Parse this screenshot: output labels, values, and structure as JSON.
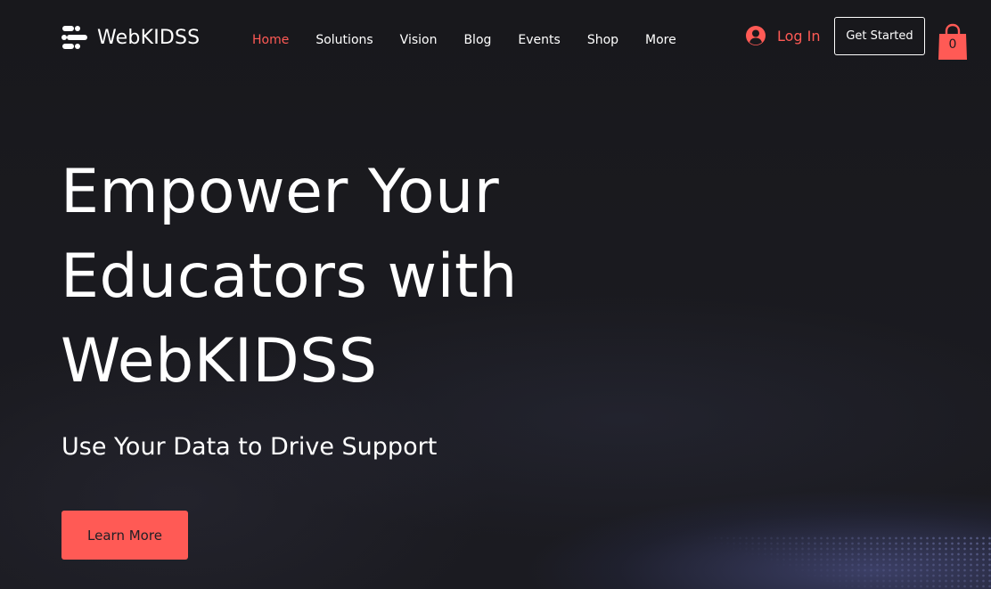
{
  "brand": {
    "name": "WebKIDSS",
    "logo_icon": "webkidss-logo-icon"
  },
  "nav": {
    "items": [
      {
        "label": "Home",
        "active": true
      },
      {
        "label": "Solutions",
        "active": false
      },
      {
        "label": "Vision",
        "active": false
      },
      {
        "label": "Blog",
        "active": false
      },
      {
        "label": "Events",
        "active": false
      },
      {
        "label": "Shop",
        "active": false
      },
      {
        "label": "More",
        "active": false
      }
    ]
  },
  "account": {
    "login_label": "Log In",
    "login_icon": "user-avatar-icon"
  },
  "header": {
    "cta_label": "Get Started"
  },
  "cart": {
    "icon": "shopping-bag-icon",
    "count": "0"
  },
  "hero": {
    "title_lines": [
      "Empower Your",
      "Educators with",
      "WebKIDSS"
    ],
    "subtitle": "Use Your Data to Drive Support",
    "button_label": "Learn More"
  },
  "colors": {
    "background": "#18181c",
    "accent": "#ff5a55",
    "text": "#ffffff"
  }
}
